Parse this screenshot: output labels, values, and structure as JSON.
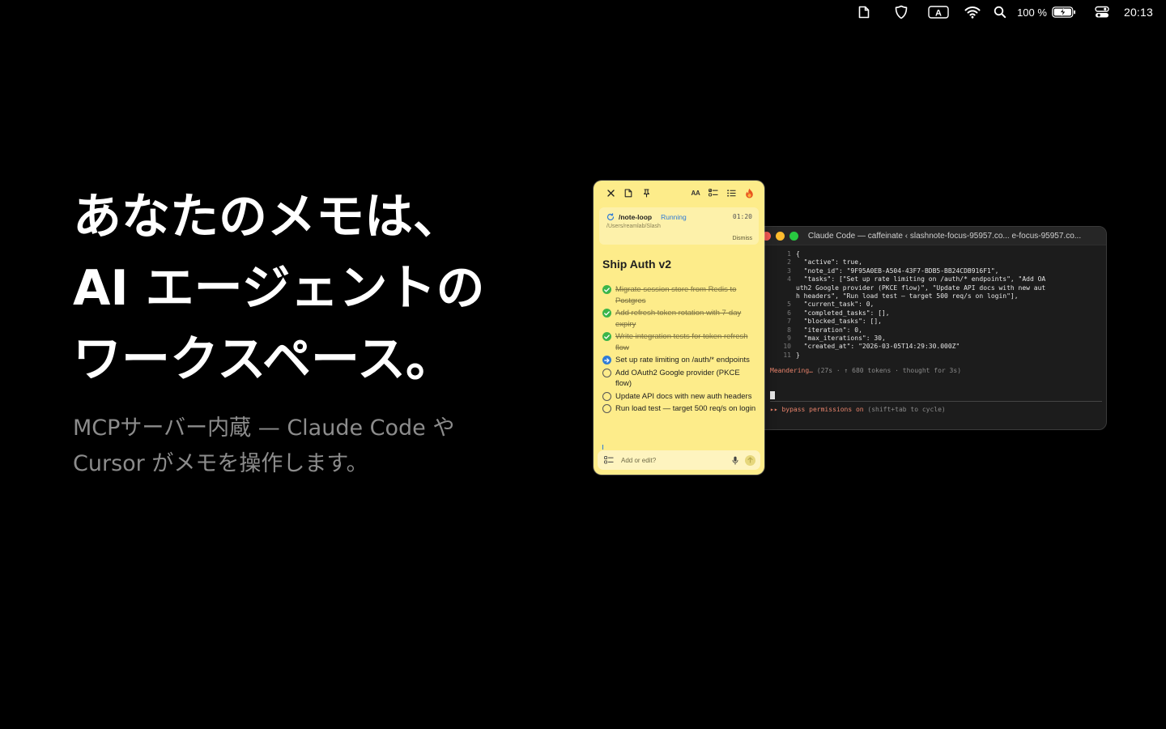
{
  "menubar": {
    "battery_percent": "100 %",
    "clock": "20:13",
    "input_source": "A"
  },
  "hero": {
    "line1": "あなたのメモは、",
    "line2": "AI エージェントの",
    "line3": "ワークスペース。",
    "sub_line1": "MCPサーバー内蔵 — Claude Code や",
    "sub_line2": "Cursor がメモを操作します。"
  },
  "note": {
    "toolbar": {
      "text_size_label": "AA"
    },
    "loop": {
      "name": "/note-loop",
      "status": "Running",
      "time": "01:20",
      "path": "/Users/reamlab/Slash",
      "dismiss": "Dismiss"
    },
    "title": "Ship Auth v2",
    "tasks": [
      {
        "text": "Migrate session store from Redis to Postgres",
        "state": "done"
      },
      {
        "text": "Add refresh token rotation with 7-day expiry",
        "state": "done"
      },
      {
        "text": "Write integration tests for token refresh flow",
        "state": "done"
      },
      {
        "text": "Set up rate limiting on /auth/* endpoints",
        "state": "active"
      },
      {
        "text": "Add OAuth2 Google provider (PKCE flow)",
        "state": "open"
      },
      {
        "text": "Update API docs with new auth headers",
        "state": "open"
      },
      {
        "text": "Run load test — target 500 req/s on login",
        "state": "open"
      }
    ],
    "input_placeholder": "Add or edit?"
  },
  "terminal": {
    "title": "Claude Code — caffeinate ‹ slashnote-focus-95957.co... e-focus-95957.co...",
    "lines": [
      {
        "n": "1",
        "text": "{"
      },
      {
        "n": "2",
        "text": "  \"active\": true,"
      },
      {
        "n": "3",
        "text": "  \"note_id\": \"9F95A0EB-A504-43F7-BDB5-BB24CDB916F1\","
      },
      {
        "n": "4",
        "text": "  \"tasks\": [\"Set up rate limiting on /auth/* endpoints\", \"Add OA"
      },
      {
        "n": "",
        "text": "uth2 Google provider (PKCE flow)\", \"Update API docs with new aut"
      },
      {
        "n": "",
        "text": "h headers\", \"Run load test — target 500 req/s on login\"],"
      },
      {
        "n": "5",
        "text": "  \"current_task\": 0,"
      },
      {
        "n": "6",
        "text": "  \"completed_tasks\": [],"
      },
      {
        "n": "7",
        "text": "  \"blocked_tasks\": [],"
      },
      {
        "n": "8",
        "text": "  \"iteration\": 0,"
      },
      {
        "n": "9",
        "text": "  \"max_iterations\": 30,"
      },
      {
        "n": "10",
        "text": "  \"created_at\": \"2026-03-05T14:29:30.000Z\""
      },
      {
        "n": "11",
        "text": "}"
      }
    ],
    "status_word": "Meandering…",
    "status_detail": " (27s · ↑ 680 tokens · thought for 3s)",
    "bypass_prefix": "▸▸ bypass permissions on",
    "bypass_hint": " (shift+tab to cycle)"
  },
  "colors": {
    "background": "#000000",
    "note_yellow": "#fdec8a",
    "done_green": "#3ab54a",
    "active_blue": "#2f7bd6",
    "terminal_bg": "#1c1c1c",
    "terminal_accent": "#e8836b",
    "subtitle_gray": "#8c8c8c"
  },
  "icons": {
    "menubar": [
      "document-icon",
      "shield-icon",
      "input-source-icon",
      "wifi-icon",
      "search-icon",
      "battery-icon",
      "control-center-icon"
    ],
    "note_toolbar": [
      "close-icon",
      "document-icon",
      "pin-icon",
      "text-size-icon",
      "checklist-icon",
      "list-icon",
      "flame-icon"
    ]
  }
}
